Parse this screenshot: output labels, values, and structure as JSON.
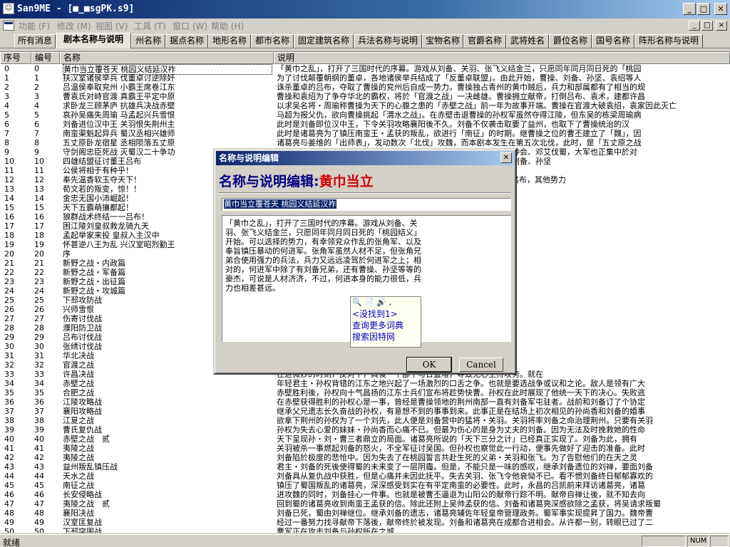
{
  "window": {
    "app_icon": "person-icon",
    "title": "San9ME - [■_■sgPK.s9]",
    "minimize_glyph": "_",
    "maximize_glyph": "□",
    "close_glyph": "✕"
  },
  "menu": {
    "items": [
      "功能 (F)",
      "修改 (M)",
      "视图 (V)",
      "工具 (T)",
      "窗口 (W)",
      "帮助 (H)"
    ],
    "mdi_min": "_",
    "mdi_restore": "□",
    "mdi_close": "×"
  },
  "tabs": [
    "所有消息",
    "剧本名称与说明",
    "州名称",
    "据点名称",
    "地形名称",
    "都市名称",
    "固定建筑名称",
    "兵法名称与说明",
    "宝物名称",
    "官爵名称",
    "武将姓名",
    "爵位名称",
    "国号名称",
    "阵形名称与说明"
  ],
  "grid": {
    "headers": {
      "index": "序号",
      "number": "编号",
      "name": "名称",
      "description": "说明"
    },
    "rows": [
      [
        "0",
        "0",
        "黄巾当立覆苍天 桃园义结延汉祚",
        "「黄巾之乱」，打开了三国时代的序幕。游戏从刘备、关羽、张飞义结金兰，只愿同年同月同日死的「桃园"
      ],
      [
        "1",
        "1",
        "扶汉室诸侯举兵 伐董卓讨逆除奸",
        "为了讨伐颠覆朝纲的董卓，各地诸侯举兵结成了「反董卓联盟」。由此开始，曹操、刘备、孙坚、袁绍等人"
      ],
      [
        "2",
        "2",
        "吕温侯奉取兖州 小霸王席卷江东",
        "诛杀董卓的吕布，夺取了曹操的兖州后自成一势力。曹操独占青州的黄巾贼后，兵力和部属都有了相当的规"
      ],
      [
        "3",
        "3",
        "曹袁氏对峙官渡 真霸王平定中原",
        "曹操和袁绍为了争夺华北的霸权，将於「官渡之战」一决雌雄。曹操拥立献帝，打倒吕布、袁术，建都许昌"
      ],
      [
        "4",
        "4",
        "求卧龙三顾茅庐 抗雄兵决战赤壁",
        "以求吴名将・周瑜称曹操为天下的心腹之患的「赤壁之战」前一年为故事开端。曹操在官渡大破袁绍，袁家因此灭亡"
      ],
      [
        "5",
        "5",
        "哀孙吴痛失周瑜 马孟起兴兵雪恨",
        "马超为报父仇，欲向曹操挑起「渭水之战」。在赤壁击退曹操的孙权军虽然夺得江陵，但东吴的栋梁周瑜病"
      ],
      [
        "6",
        "6",
        "刘备进位汉中王 关羽恨失荆州主",
        "此时是刘备即位汉中王，下令关羽攻略襄阳後不久。刘备不仅袭击取要了益州，也取下了曹操统治的汉"
      ],
      [
        "7",
        "7",
        "南蛮渠魁起异兵 蜀汉丞相兴雄师",
        "此时是诸葛亮为了镇压南蛮王・孟获的叛乱，欲进行「南征」的时期。继曹操之位的曹丕建立了「魏」，因"
      ],
      [
        "8",
        "8",
        "五丈原卧龙宿星 丞相陨落五丈原",
        "诸葛亮与姜维的「出师表」，发动数次「北伐」攻魏，而本剧本发生在第五次北伐，此时，是「五丈原之战"
      ],
      [
        "9",
        "9",
        "守剑阁忠臣死战 灭蜀汉二十争功",
        "姜维与钟会、邓艾作战，诸葛亮之後继者，终於迫降蜀汉，司马昭令钟会、邓艾伐蜀，大军也正集中於对"
      ],
      [
        "10",
        "10",
        "四雄结盟征讨董王吕布",
        "曹操、刘备、孙坚、马超、公孙瓒等势力，迅速发展壮大，而曹操、刘备、孙坚"
      ],
      [
        "11",
        "11",
        "公侯将相于有种乎！",
        "天下大局势！人才备出的争霸时期，随着英杰的"
      ],
      [
        "12",
        "12",
        "奉先温香软玉夺天下！",
        "此时是於汉军之中，诛杀董卓的吕布建立不世。194年，诛杀董卓的吕布，其他势力"
      ],
      [
        "13",
        "13",
        "荀文若的叛变，惊！！",
        "曹操的军师荀彧在此时叛变，诸侯们於东都大乱，曹操商议兴兵抵故"
      ],
      [
        "14",
        "14",
        "金忠无国小沛崛起！",
        "刘备在此处起兵，由小沛崛起开始正在此时，天下大乱。刘备据定一"
      ],
      [
        "15",
        "15",
        "天下五霸萌攘都起！",
        "此时为天下五霸，曹操为抗衡袁绍，亲自此次衰大失所从了"
      ],
      [
        "16",
        "16",
        "狼群战术终结一一吕布！",
        ""
      ],
      [
        "17",
        "17",
        "困江陵刘皇叔救龙骑九天",
        "刘备不长，孙权由于惧怕曹操，竞然宣布效"
      ],
      [
        "18",
        "18",
        "孟起举家来投 皇叔入主汉中",
        "书信被告发後，双方大战於浴水。同时马超"
      ],
      [
        "19",
        "19",
        "怀甚逆八王为乱 兴汉室昭烈勤王",
        "仍然存在的衰落，以魏王为首的各路诸侯均可献奉"
      ],
      [
        "20",
        "20",
        "序",
        "该地图是符合玩家能够将自体验本游戏数学。"
      ],
      [
        "21",
        "21",
        "新野之战・内政篇",
        "需寻访人材，蓄搭英杰以至民富国之法。"
      ],
      [
        "22",
        "22",
        "新野之战・军备篇",
        "武将必须可讨本篇数学。在这里您可体验四种"
      ],
      [
        "23",
        "23",
        "新野之战・出征篇",
        "此相关事宜。您将在此实地调兵遣将，击退敌"
      ],
      [
        "24",
        "24",
        "新野之战・攻城篇",
        "城中的人可不能错过。您可从数学中学习：建"
      ],
      [
        "25",
        "25",
        "下邳攻防战",
        "中乱。不论您想要用侦听手计成就"
      ],
      [
        "26",
        "26",
        "兴师雪恨",
        "夺，在徐州被阿谢的手下所杀。曹操插上「"
      ],
      [
        "27",
        "27",
        "伤寄讨伐战",
        "操的根据地。那就是青袁董卓的吴越・吕"
      ],
      [
        "28",
        "28",
        "濮阳防卫战",
        "吕布夺得此地作为基地的话，情势将会变"
      ],
      [
        "29",
        "29",
        "吕布讨伐战",
        "，需谨能操控吕布的陈宫，其是非同小可。"
      ],
      [
        "30",
        "30",
        "张绣讨伐战",
        "说服张绣降其军师・贾诩的智略害灾城护"
      ],
      [
        "31",
        "31",
        "华北决战",
        "开取得河北的袁绍，与曹操自幼相识的袁绍"
      ],
      [
        "32",
        "32",
        "官渡之战",
        "孙，也因此平定了河北的袁绍下个目标"
      ],
      [
        "33",
        "33",
        "许昌决战",
        "在这微妙的时刻，反对下，其後一个部下与日益增，导致无心主持攻务。就在"
      ],
      [
        "34",
        "34",
        "赤壁之战",
        "年轻君主・孙权背错的江东之地兴起了一场激烈的口舌之争。也就是要选战争或议和之论。敌人是领有广大"
      ],
      [
        "35",
        "35",
        "合肥之战",
        "赤壁胜利後，孙权向十气昌扬的江东士兵们宣布将趁势快曹。孙权在此时展现了他统一天下的决心。失败逃"
      ],
      [
        "36",
        "36",
        "江陵攻略战",
        "在赤壁获得胜利的孙权心是一事，曾经是曹操领地的荆州南部一直有刘备军屯驻者。战前和刘备订了个协定"
      ],
      [
        "37",
        "37",
        "襄阳攻略战",
        "继承父兄遗志长久奋战的孙权，有意想不到的事事到来。此事正是在结场上初次相见的孙尚香和刘备的婚事"
      ],
      [
        "38",
        "38",
        "江夏之战",
        "欲拿下荆州的孙权为了一个刘先，此人便是刘备营中的猛将・关羽。关羽将率刘备之命治理荆州。只要有关羽"
      ],
      [
        "39",
        "39",
        "曹氏复仇战",
        "孙权为失去心爱的妹妹・孙尚香而心痛不已。但最为伤心的是身为丈夫的刘备。因为无法及时挽救她的性命"
      ],
      [
        "40",
        "40",
        "赤壁之战　贰",
        "天下呈现孙・刘・曹三者鼎立的局面。诸葛亮所说的「天下三分之计」已经真正实现了。刘备为此，拥有"
      ],
      [
        "41",
        "41",
        "夷陵之战",
        "关羽被杀一事燃起刘备的怒火，不全军征讨吴国。但孙权也察觉此一行动，便事先做好了迎击的准备。此时"
      ],
      [
        "42",
        "42",
        "夷陵之战",
        "刘备陷於极度的悲怆中。因为失去了在桃园誓言共赴生死的义弟・关羽和张飞。为了告慰他们的在天之灵"
      ],
      [
        "43",
        "43",
        "益州叛乱镇压战",
        "君主・刘备的死後使得蜀的未来变了一层阴霾。但是，不能只是一味的感叹，继承刘备遗位的刘禅，要面刘备"
      ],
      [
        "44",
        "44",
        "天水之战",
        "刘备具从复仇战中获胜，但是心痛并未因此抚平。失去关羽、张飞令他衰恸不已。看不惯刘备终日郁郁寡欢的"
      ],
      [
        "45",
        "45",
        "南征之战",
        "镇压了蜀国叛乱的诸葛亮，深深感受到实在有平定南蛮的必要性。此时，永昌的吕凯前来拜访诸葛亮，诸葛"
      ],
      [
        "46",
        "46",
        "长安侵略战",
        "进攻魏的同时，刘备挂心一件事。也就是被曹丕逼退为山阳公的献帝行踪不明。献帝自禅让後，就不知去向"
      ],
      [
        "47",
        "47",
        "夷陵之战　贰",
        "回到蜀的诸葛亮收到南蛮王孟获的信。除此还附上吴帅孟获的信。刘备和诸葛亮深感欲除之孟获，将吴请求叛蜀"
      ],
      [
        "48",
        "48",
        "襄阳决战",
        "刘备已死，蜀由刘禅继位。继承刘备的遗志，诸葛亮辅佐年轻皇帝管理政务。蜀军事实现提昇了国力。魏帝曹"
      ],
      [
        "49",
        "49",
        "汉室匡复战",
        "经过一番努力找寻献帝下落後，献帝终於被发现。刘备和诸葛亮在成都合进相会。从许都一别，转眼已过了二"
      ],
      [
        "50",
        "50",
        "下邳突围战",
        "曹军正在攻击刘备与孙权所在之城..."
      ]
    ]
  },
  "status": {
    "text": "就绪",
    "num": "NUM"
  },
  "dialog": {
    "title": "名称与说明编辑",
    "close_glyph": "✕",
    "heading_prefix": "名称与说明编辑:",
    "heading_value": "黄巾当立",
    "name_value": "黄巾当立覆苍天 桃园义结延汉祚",
    "description": "「黄巾之乱」，打开了三国时代的序幕。游戏从刘备、关\n羽、张飞义结金兰，只愿同年同月同日死的「桃园结义」\n开始。可以选择的势力，有幸领兖众作乱的张角军、以及\n奉旨镇压暴动的何进军。张角军虽然人材不足，但张角兄\n弟合使用强力的兵法，兵力又远远凌驾於何进军之上；相\n对的，何进军中除了有刘备兄弟，还有曹操、孙坚等等的\n豪杰，可说是人材济济，不过，何进本身的能力很低，兵\n力也相差甚远。",
    "popup": {
      "icons": "🔍 📄 🔊 ,",
      "not_found": "<没找到1>",
      "more_dict": "查询更多词典",
      "search_web": "搜索因特网"
    },
    "ok_label": "OK",
    "cancel_label": "Cancel"
  }
}
